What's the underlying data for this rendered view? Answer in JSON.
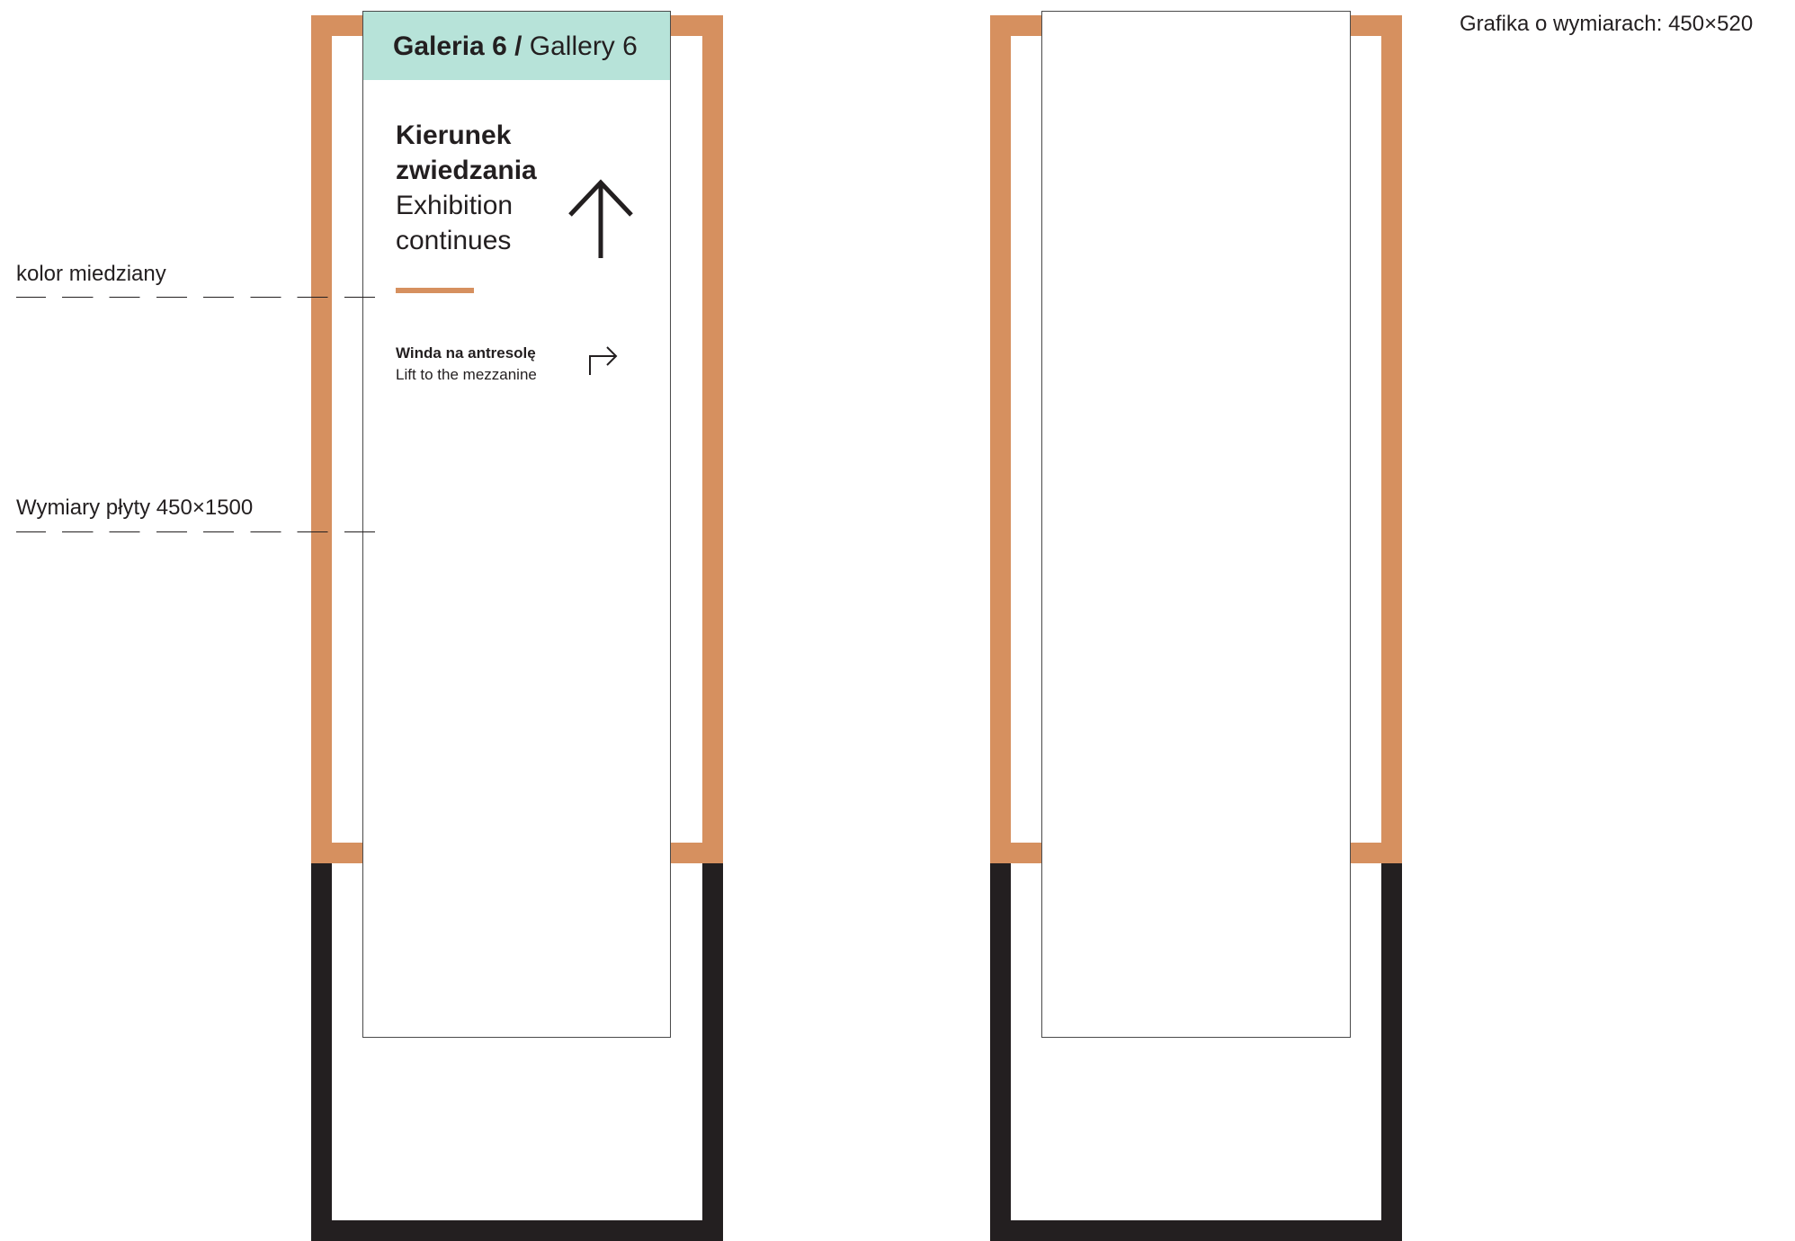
{
  "colors": {
    "copper": "#d6905f",
    "dark_frame": "#231f20",
    "header_mint": "#b7e3d9",
    "panel_border": "#4a4a4a"
  },
  "left_sign": {
    "header": {
      "bold": "Galeria 6 /",
      "light": "Gallery 6"
    },
    "direction": {
      "bold_lines": [
        "Kierunek",
        "zwiedzania"
      ],
      "light_lines": [
        "Exhibition",
        "continues"
      ],
      "icon": "arrow-up-icon"
    },
    "lift": {
      "bold": "Winda na antresolę",
      "light": "Lift to the mezzanine",
      "icon": "turn-right-arrow-icon"
    }
  },
  "annotations": {
    "copper_color": "kolor miedziany",
    "plate_dimensions": "Wymiary płyty 450×1500",
    "graphic_dimensions": "Grafika o wymiarach: 450×520"
  }
}
